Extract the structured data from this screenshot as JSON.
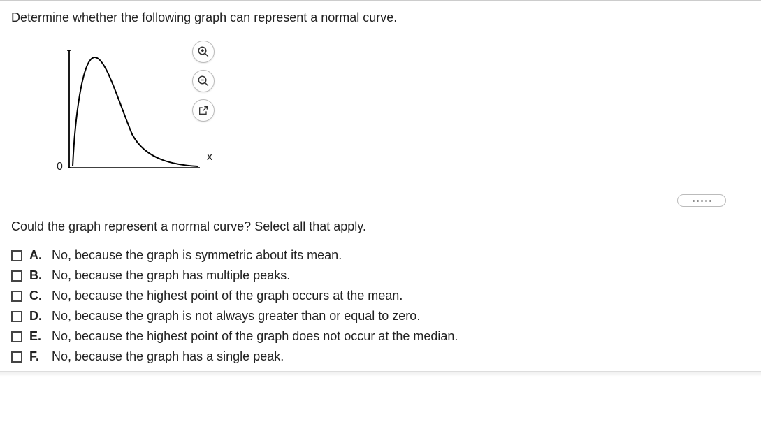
{
  "question": "Determine whether the following graph can represent a normal curve.",
  "graph": {
    "zero_label": "0",
    "x_label": "x"
  },
  "tools": {
    "zoom_in": "zoom-in",
    "zoom_out": "zoom-out",
    "open": "open-external"
  },
  "subquestion": "Could the graph represent a normal curve? Select all that apply.",
  "options": [
    {
      "letter": "A.",
      "text": "No, because the graph is symmetric about its mean."
    },
    {
      "letter": "B.",
      "text": "No, because the graph has multiple peaks."
    },
    {
      "letter": "C.",
      "text": "No, because the highest point of the graph occurs at the mean."
    },
    {
      "letter": "D.",
      "text": "No, because the graph is not always greater than or equal to zero."
    },
    {
      "letter": "E.",
      "text": "No, because the highest point of the graph does not occur at the median."
    },
    {
      "letter": "F.",
      "text": "No, because the graph has a single peak."
    }
  ]
}
